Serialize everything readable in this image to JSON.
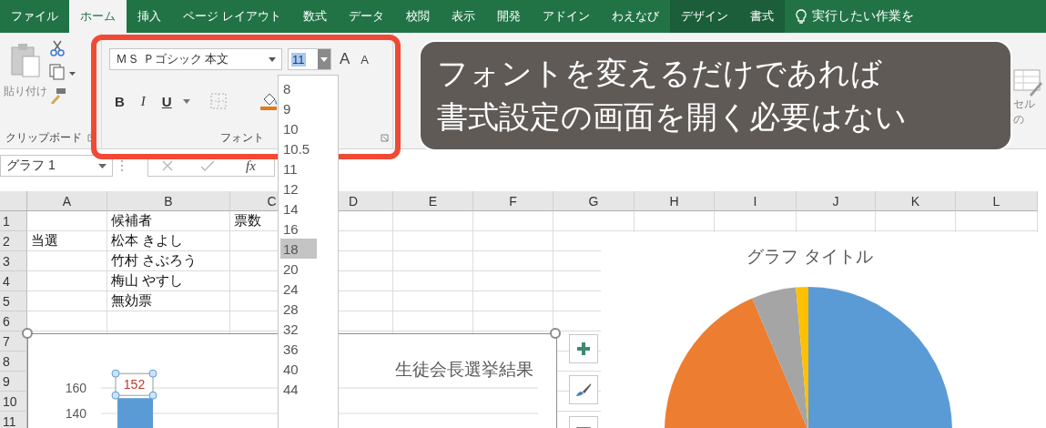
{
  "tabs": [
    {
      "label": "ファイル",
      "selected": false,
      "kind": "normal"
    },
    {
      "label": "ホーム",
      "selected": true,
      "kind": "normal"
    },
    {
      "label": "挿入",
      "selected": false,
      "kind": "normal"
    },
    {
      "label": "ページ レイアウト",
      "selected": false,
      "kind": "normal"
    },
    {
      "label": "数式",
      "selected": false,
      "kind": "normal"
    },
    {
      "label": "データ",
      "selected": false,
      "kind": "normal"
    },
    {
      "label": "校閲",
      "selected": false,
      "kind": "normal"
    },
    {
      "label": "表示",
      "selected": false,
      "kind": "normal"
    },
    {
      "label": "開発",
      "selected": false,
      "kind": "normal"
    },
    {
      "label": "アドイン",
      "selected": false,
      "kind": "normal"
    },
    {
      "label": "わえなび",
      "selected": false,
      "kind": "normal"
    },
    {
      "label": "デザイン",
      "selected": false,
      "kind": "context"
    },
    {
      "label": "書式",
      "selected": false,
      "kind": "context"
    }
  ],
  "tell_me": {
    "placeholder": "実行したい作業を"
  },
  "ribbon": {
    "clipboard": {
      "paste": "貼り付け",
      "label": "クリップボード"
    },
    "font": {
      "font_name": "ＭＳ Ｐゴシック 本文",
      "font_size": "11",
      "grow": "A",
      "shrink": "A",
      "bold": "B",
      "italic": "I",
      "underline": "U",
      "label": "フォント"
    },
    "styles": {
      "cell_styles": "セルの"
    }
  },
  "callout": {
    "lines": [
      "フォントを変えるだけであれば",
      "書式設定の画面を開く必要はない"
    ]
  },
  "size_dropdown": {
    "items": [
      {
        "label": "8",
        "selected": false
      },
      {
        "label": "9",
        "selected": false
      },
      {
        "label": "10",
        "selected": false
      },
      {
        "label": "10.5",
        "selected": false
      },
      {
        "label": "11",
        "selected": false
      },
      {
        "label": "12",
        "selected": false
      },
      {
        "label": "14",
        "selected": false
      },
      {
        "label": "16",
        "selected": false
      },
      {
        "label": "18",
        "selected": true
      },
      {
        "label": "20",
        "selected": false
      },
      {
        "label": "24",
        "selected": false
      },
      {
        "label": "28",
        "selected": false
      },
      {
        "label": "32",
        "selected": false
      },
      {
        "label": "36",
        "selected": false
      },
      {
        "label": "40",
        "selected": false
      },
      {
        "label": "44",
        "selected": false
      }
    ]
  },
  "formula_bar": {
    "name_box": "グラフ 1",
    "fx": "fx"
  },
  "sheet": {
    "columns": [
      "A",
      "B",
      "C",
      "D",
      "E",
      "F",
      "G",
      "H",
      "I",
      "J",
      "K",
      "L"
    ],
    "rows": [
      {
        "label": "1",
        "b": "候補者",
        "c": "票数"
      },
      {
        "label": "2",
        "a": "当選",
        "b": "松本 きよし"
      },
      {
        "label": "3",
        "b": "竹村 さぶろう"
      },
      {
        "label": "4",
        "b": "梅山 やすし"
      },
      {
        "label": "5",
        "b": "無効票"
      },
      {
        "label": "6"
      },
      {
        "label": "7"
      },
      {
        "label": "8"
      },
      {
        "label": "9"
      },
      {
        "label": "10"
      },
      {
        "label": "11"
      }
    ]
  },
  "bar_chart": {
    "chart_data": {
      "type": "bar",
      "title": "生徒会長選挙結果",
      "ylim": [
        0,
        160
      ],
      "yticks": [
        140,
        160
      ],
      "values": [
        152
      ],
      "data_labels": true
    }
  },
  "pie_chart": {
    "title": "グラフ タイトル"
  }
}
